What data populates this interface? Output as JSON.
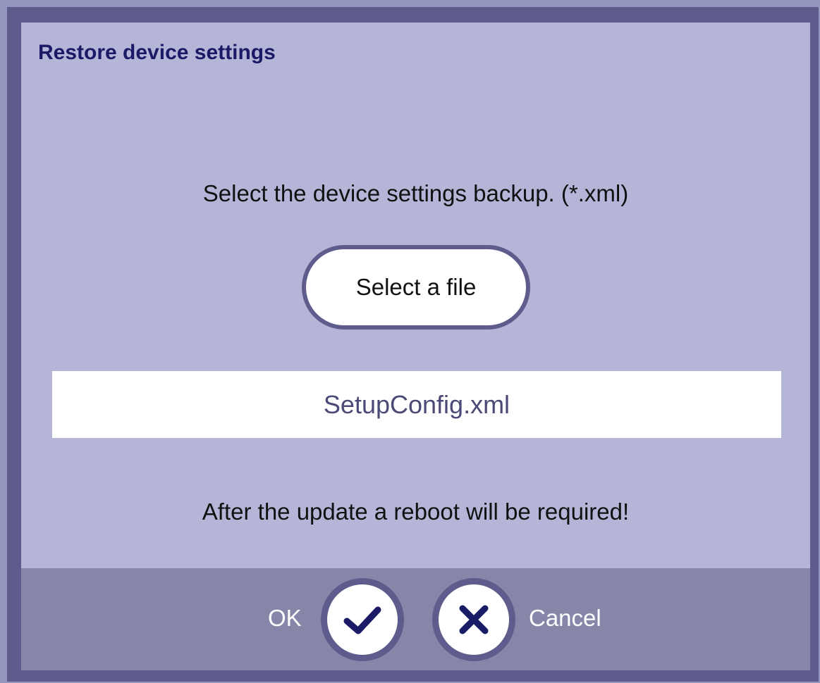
{
  "dialog": {
    "title": "Restore device settings",
    "instruction": "Select the device settings backup. (*.xml)",
    "select_button_label": "Select a file",
    "selected_file": "SetupConfig.xml",
    "warning": "After the update a reboot will be required!"
  },
  "footer": {
    "ok_label": "OK",
    "cancel_label": "Cancel"
  },
  "icons": {
    "ok": "checkmark-icon",
    "cancel": "close-icon"
  },
  "colors": {
    "outer_frame": "#5d5c8c",
    "dialog_background": "#b5b5d8",
    "footer_background": "#8686a9",
    "title_text": "#1a1a66",
    "icon_color": "#1a1a66"
  }
}
